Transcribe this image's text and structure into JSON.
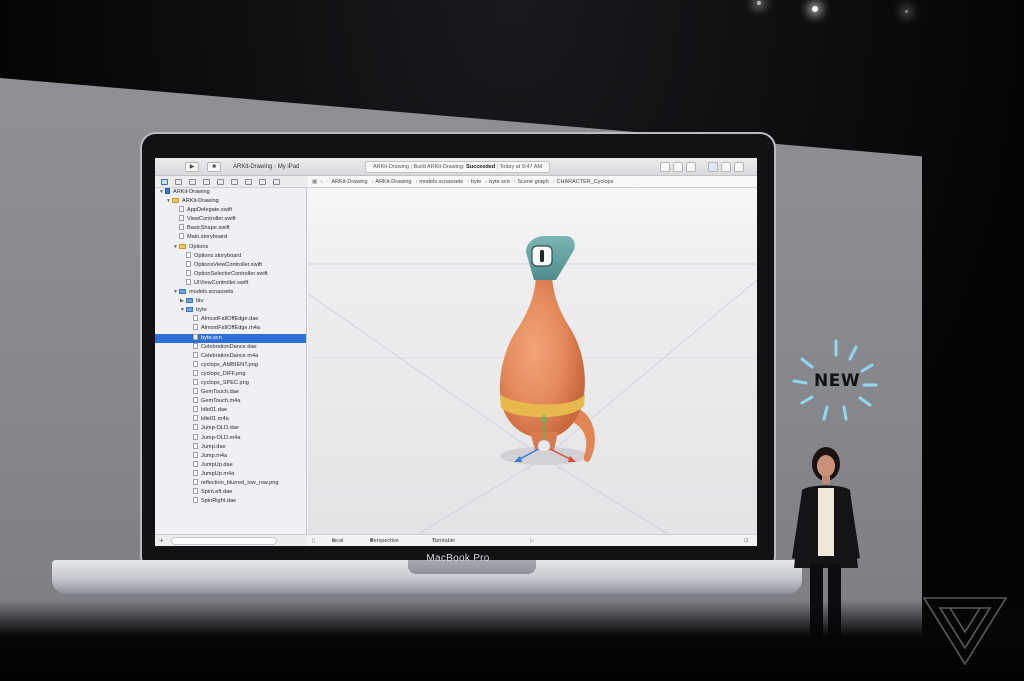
{
  "colors": {
    "selection": "#2f6fd6",
    "character_body": "#e48a5a",
    "character_head": "#6fa7a6",
    "belt": "#e8b84d",
    "new_badge_rays": "#8fd8ef"
  },
  "laptop": {
    "brand": "MacBook Pro"
  },
  "xcode": {
    "toolbar": {
      "run_icon": "play-icon",
      "stop_icon": "stop-icon",
      "scheme": "ARKit-Drawing",
      "device": "My iPad",
      "status_project": "ARKit-Drawing",
      "status_build_prefix": "Build ARKit-Drawing:",
      "status_build_result": "Succeeded",
      "status_time": "Today at 9:47 AM"
    },
    "navigator": {
      "rows": [
        {
          "label": "ARKit-Drawing",
          "indent": 0,
          "kind": "proj",
          "tri": "▼"
        },
        {
          "label": "ARKit-Drawing",
          "indent": 1,
          "kind": "folder",
          "tri": "▼"
        },
        {
          "label": "AppDelegate.swift",
          "indent": 2,
          "kind": "file",
          "tri": ""
        },
        {
          "label": "ViewController.swift",
          "indent": 2,
          "kind": "file",
          "tri": ""
        },
        {
          "label": "BasicShape.swift",
          "indent": 2,
          "kind": "file",
          "tri": ""
        },
        {
          "label": "Main.storyboard",
          "indent": 2,
          "kind": "file",
          "tri": ""
        },
        {
          "label": "Options",
          "indent": 2,
          "kind": "folder",
          "tri": "▼"
        },
        {
          "label": "Options.storyboard",
          "indent": 3,
          "kind": "file",
          "tri": ""
        },
        {
          "label": "OptionsViewController.swift",
          "indent": 3,
          "kind": "file",
          "tri": ""
        },
        {
          "label": "OptionSelectorController.swift",
          "indent": 3,
          "kind": "file",
          "tri": ""
        },
        {
          "label": "UIViewController.swift",
          "indent": 3,
          "kind": "file",
          "tri": ""
        },
        {
          "label": "models.scnassets",
          "indent": 2,
          "kind": "bluefolder",
          "tri": "▼"
        },
        {
          "label": "blu",
          "indent": 3,
          "kind": "bluefolder",
          "tri": "▶"
        },
        {
          "label": "byte",
          "indent": 3,
          "kind": "bluefolder",
          "tri": "▼"
        },
        {
          "label": "AlmostFallOffEdge.dae",
          "indent": 4,
          "kind": "file",
          "tri": ""
        },
        {
          "label": "AlmostFallOffEdge.m4a",
          "indent": 4,
          "kind": "file",
          "tri": ""
        },
        {
          "label": "byte.scn",
          "indent": 4,
          "kind": "file",
          "tri": "",
          "selected": true
        },
        {
          "label": "CelebrationDance.dae",
          "indent": 4,
          "kind": "file",
          "tri": ""
        },
        {
          "label": "CelebrationDance.m4a",
          "indent": 4,
          "kind": "file",
          "tri": ""
        },
        {
          "label": "cyclops_AMBIENT.png",
          "indent": 4,
          "kind": "file",
          "tri": ""
        },
        {
          "label": "cyclops_DIFF.png",
          "indent": 4,
          "kind": "file",
          "tri": ""
        },
        {
          "label": "cyclops_SPEC.png",
          "indent": 4,
          "kind": "file",
          "tri": ""
        },
        {
          "label": "GemTouch.dae",
          "indent": 4,
          "kind": "file",
          "tri": ""
        },
        {
          "label": "GemTouch.m4a",
          "indent": 4,
          "kind": "file",
          "tri": ""
        },
        {
          "label": "Idle01.dae",
          "indent": 4,
          "kind": "file",
          "tri": ""
        },
        {
          "label": "Idle01.m4a",
          "indent": 4,
          "kind": "file",
          "tri": ""
        },
        {
          "label": "Jump-OLD.dae",
          "indent": 4,
          "kind": "file",
          "tri": ""
        },
        {
          "label": "Jump-OLD.m4a",
          "indent": 4,
          "kind": "file",
          "tri": ""
        },
        {
          "label": "Jump.dae",
          "indent": 4,
          "kind": "file",
          "tri": ""
        },
        {
          "label": "Jump.m4a",
          "indent": 4,
          "kind": "file",
          "tri": ""
        },
        {
          "label": "JumpUp.dae",
          "indent": 4,
          "kind": "file",
          "tri": ""
        },
        {
          "label": "JumpUp.m4a",
          "indent": 4,
          "kind": "file",
          "tri": ""
        },
        {
          "label": "reflection_blurred_low_row.png",
          "indent": 4,
          "kind": "file",
          "tri": ""
        },
        {
          "label": "SpinLeft.dae",
          "indent": 4,
          "kind": "file",
          "tri": ""
        },
        {
          "label": "SpinRight.dae",
          "indent": 4,
          "kind": "file",
          "tri": ""
        }
      ]
    },
    "jumpbar": {
      "crumbs": [
        "ARKit-Drawing",
        "ARKit-Drawing",
        "models.scnassets",
        "byte",
        "byte.scn",
        "Scene graph",
        "CHARACTER_Cyclops"
      ]
    },
    "scene_bar": {
      "local": "local",
      "perspective": "Perspective",
      "turntable": "Turntable"
    }
  },
  "badge": {
    "text": "NEW"
  }
}
